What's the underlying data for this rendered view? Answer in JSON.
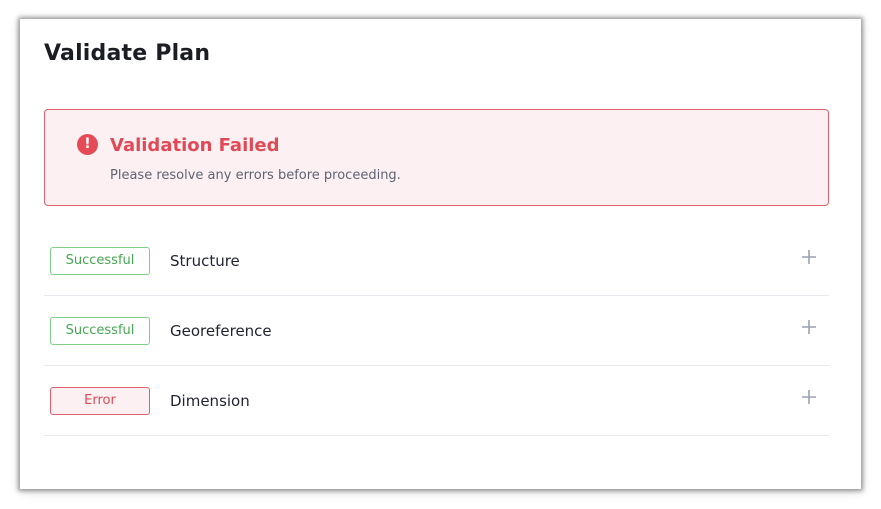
{
  "page": {
    "title": "Validate Plan"
  },
  "alert": {
    "icon": "exclamation-circle-icon",
    "title": "Validation Failed",
    "message": "Please resolve any errors before proceeding.",
    "colors": {
      "accent": "#e54b57",
      "background": "#fdf0f2"
    }
  },
  "checks": [
    {
      "status": "Successful",
      "label": "Structure",
      "expand_icon": "plus-icon"
    },
    {
      "status": "Successful",
      "label": "Georeference",
      "expand_icon": "plus-icon"
    },
    {
      "status": "Error",
      "label": "Dimension",
      "expand_icon": "plus-icon"
    }
  ],
  "colors": {
    "success": "#45a652",
    "error": "#d94c58",
    "icon_gray": "#9aa1ad"
  }
}
